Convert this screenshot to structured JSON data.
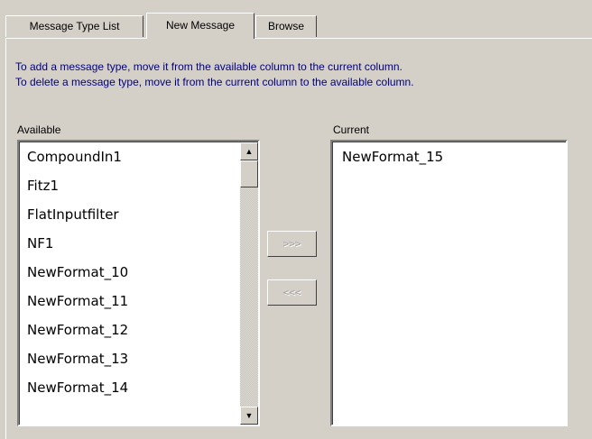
{
  "tabs": [
    {
      "label": "Message Type List",
      "active": false
    },
    {
      "label": "New Message",
      "active": true
    },
    {
      "label": "Browse",
      "active": false
    }
  ],
  "instructions": {
    "line1": "To add a message type, move it from the available column to the current column.",
    "line2": "To delete a message type, move it from the current column to the available column."
  },
  "available": {
    "label": "Available",
    "items": [
      "CompoundIn1",
      "Fitz1",
      "FlatInputfilter",
      "NF1",
      "NewFormat_10",
      "NewFormat_11",
      "NewFormat_12",
      "NewFormat_13",
      "NewFormat_14"
    ]
  },
  "current": {
    "label": "Current",
    "items": [
      "NewFormat_15"
    ]
  },
  "buttons": {
    "add_label": ">>>",
    "add_enabled": false,
    "remove_label": "<<<",
    "remove_enabled": false
  },
  "icons": {
    "scroll_up": "scroll-up-arrow-icon",
    "scroll_down": "scroll-down-arrow-icon"
  },
  "colors": {
    "background": "#d4d0c8",
    "instruction_text": "#000080",
    "list_background": "#ffffff"
  }
}
